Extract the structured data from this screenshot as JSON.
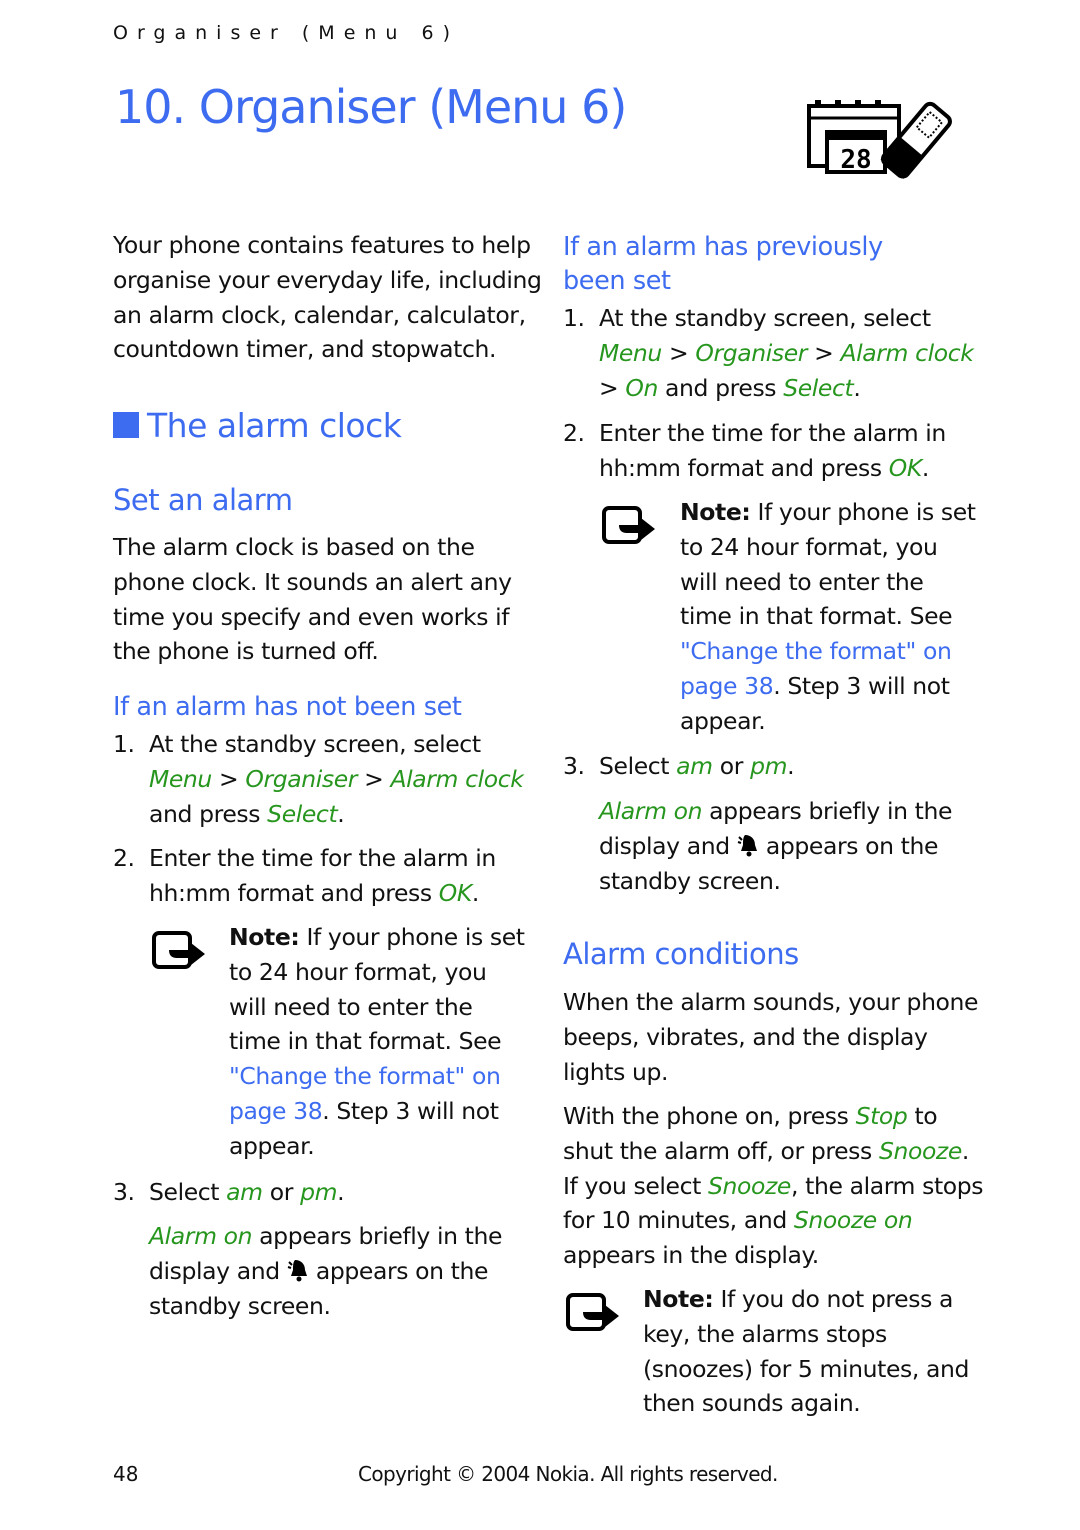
{
  "running_head": "Organiser (Menu 6)",
  "chapter_title": "10. Organiser (Menu 6)",
  "chapter_icon": "calendar-phone-icon",
  "intro": [
    "Your phone contains features to help",
    "organise your everyday life, including",
    "an alarm clock, calendar, calculator,",
    "countdown timer, and stopwatch."
  ],
  "section_alarm_clock": "The alarm clock",
  "set_alarm": {
    "heading": "Set an alarm",
    "body": [
      "The alarm clock is based on the",
      "phone clock. It sounds an alert any",
      "time you specify and even works if",
      "the phone is turned off."
    ]
  },
  "not_set": {
    "heading": "If an alarm has not been set",
    "step1": {
      "num": "1.",
      "line1": "At the standby screen, select",
      "menu": "Menu",
      "sep": " > ",
      "organiser": "Organiser",
      "alarm_clock": "Alarm clock",
      "and_press": "and press ",
      "select": "Select",
      "period": "."
    },
    "step2": {
      "num": "2.",
      "line1": "Enter the time for the alarm in",
      "line2_pre": "hh:mm format and press ",
      "ok": "OK",
      "period": "."
    },
    "note": {
      "label": "Note:",
      "l1": " If your phone is set",
      "l2": "to 24 hour format, you",
      "l3": "will need to enter the",
      "l4": "time in that format. See",
      "link1": "\"Change the format\" on",
      "link2": "page 38",
      "l6": ". Step 3 will not",
      "l7": "appear."
    },
    "step3": {
      "num": "3.",
      "pre": "Select ",
      "am": "am",
      "or": " or ",
      "pm": "pm",
      "period": "."
    },
    "result": {
      "alarm_on": "Alarm on",
      "l1": " appears briefly in the",
      "l2_pre": "display and ",
      "l2_post": " appears on the",
      "l3": "standby screen."
    }
  },
  "prev_set": {
    "heading_l1": "If an alarm has previously",
    "heading_l2": "been set",
    "step1": {
      "num": "1.",
      "line1": "At the standby screen, select",
      "menu": "Menu",
      "sep": " > ",
      "organiser": "Organiser",
      "alarm_clock": "Alarm clock",
      "gt": "> ",
      "on": "On",
      "and_press": " and press ",
      "select": "Select",
      "period": "."
    },
    "step2": {
      "num": "2.",
      "line1": "Enter the time for the alarm in",
      "line2_pre": "hh:mm format and press ",
      "ok": "OK",
      "period": "."
    },
    "note": {
      "label": "Note:",
      "l1": " If your phone is set",
      "l2": "to 24 hour format, you",
      "l3": "will need to enter the",
      "l4": "time in that format. See",
      "link1": "\"Change the format\" on",
      "link2": "page 38",
      "l6": ". Step 3 will not",
      "l7": "appear."
    },
    "step3": {
      "num": "3.",
      "pre": "Select ",
      "am": "am",
      "or": " or ",
      "pm": "pm",
      "period": "."
    },
    "result": {
      "alarm_on": "Alarm on",
      "l1": " appears briefly in the",
      "l2_pre": "display and ",
      "l2_post": " appears on the",
      "l3": "standby screen."
    }
  },
  "conditions": {
    "heading": "Alarm conditions",
    "p1": [
      "When the alarm sounds, your phone",
      "beeps, vibrates, and the display",
      "lights up."
    ],
    "p2": {
      "l1_pre": "With the phone on, press ",
      "stop": "Stop",
      "l1_post": " to",
      "l2_pre": "shut the alarm off, or press ",
      "snooze": "Snooze",
      "l2_post": ".",
      "l3_pre": "If you select ",
      "snooze2": "Snooze",
      "l3_post": ", the alarm stops",
      "l4_pre": "for 10 minutes, and ",
      "snooze_on": "Snooze on",
      "l5": "appears in the display."
    },
    "note": {
      "label": "Note:",
      "l1": " If you do not press a",
      "l2": "key, the alarms stops",
      "l3": "(snoozes) for 5 minutes, and",
      "l4": "then sounds again."
    }
  },
  "footer": {
    "page_number": "48",
    "copyright": "Copyright © 2004 Nokia. All rights reserved."
  },
  "colors": {
    "heading_blue": "#3d6cf0",
    "softkey_green": "#27961e",
    "text": "#111111"
  }
}
